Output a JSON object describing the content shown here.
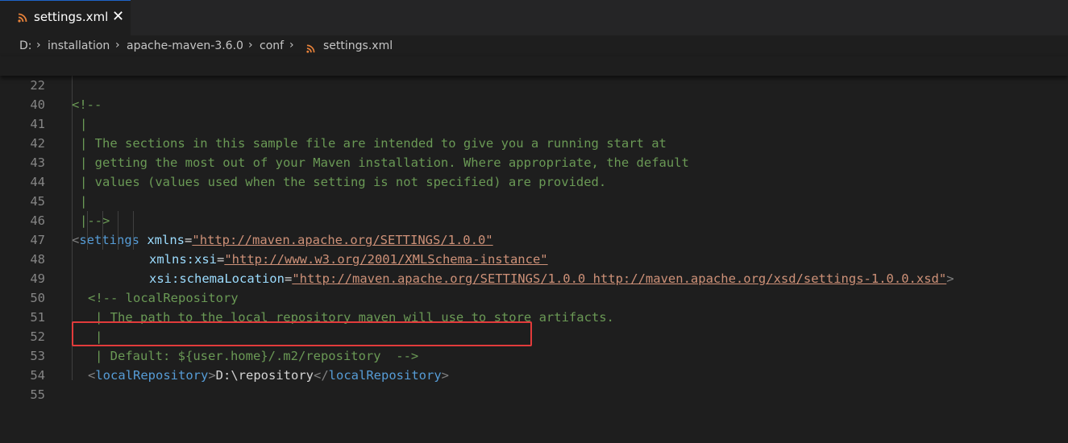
{
  "tab": {
    "label": "settings.xml",
    "close": "✕"
  },
  "breadcrumb": {
    "items": [
      "D:",
      "installation",
      "apache-maven-3.6.0",
      "conf",
      "settings.xml"
    ],
    "separator": "›"
  },
  "sticky": {
    "line_number": "22",
    "code": "<!--"
  },
  "lines": [
    {
      "n": "40",
      "code": "|"
    },
    {
      "n": "41",
      "code": "| The sections in this sample file are intended to give you a running start at"
    },
    {
      "n": "42",
      "code": "| getting the most out of your Maven installation. Where appropriate, the default"
    },
    {
      "n": "43",
      "code": "| values (values used when the setting is not specified) are provided."
    },
    {
      "n": "44",
      "code": "|"
    },
    {
      "n": "45",
      "code": "|-->"
    },
    {
      "n": "46",
      "open": "<",
      "tag": "settings",
      "attr": "xmlns",
      "eq": "=",
      "val": "\"http://maven.apache.org/SETTINGS/1.0.0\""
    },
    {
      "n": "47",
      "attr": "xmlns:xsi",
      "eq": "=",
      "val": "\"http://www.w3.org/2001/XMLSchema-instance\""
    },
    {
      "n": "48",
      "attr": "xsi:schemaLocation",
      "eq": "=",
      "val": "\"http://maven.apache.org/SETTINGS/1.0.0 http://maven.apache.org/xsd/settings-1.0.0.xsd\"",
      "close": ">"
    },
    {
      "n": "49",
      "code": "<!-- localRepository"
    },
    {
      "n": "50",
      "code": "| The path to the local repository maven will use to store artifacts."
    },
    {
      "n": "51",
      "code": "|"
    },
    {
      "n": "52",
      "code": "| Default: ${user.home}/.m2/repository  -->"
    },
    {
      "n": "53",
      "open": "<",
      "tag": "localRepository",
      "gt": ">",
      "text": "D:\\repository",
      "end_open": "</",
      "end_tag": "localRepository",
      "end_gt": ">"
    },
    {
      "n": "54",
      "code": ""
    },
    {
      "n": "55",
      "code": ""
    }
  ],
  "colors": {
    "accent": "#1e64c8",
    "highlight": "#e23b3b",
    "rss": "#e8823a"
  }
}
